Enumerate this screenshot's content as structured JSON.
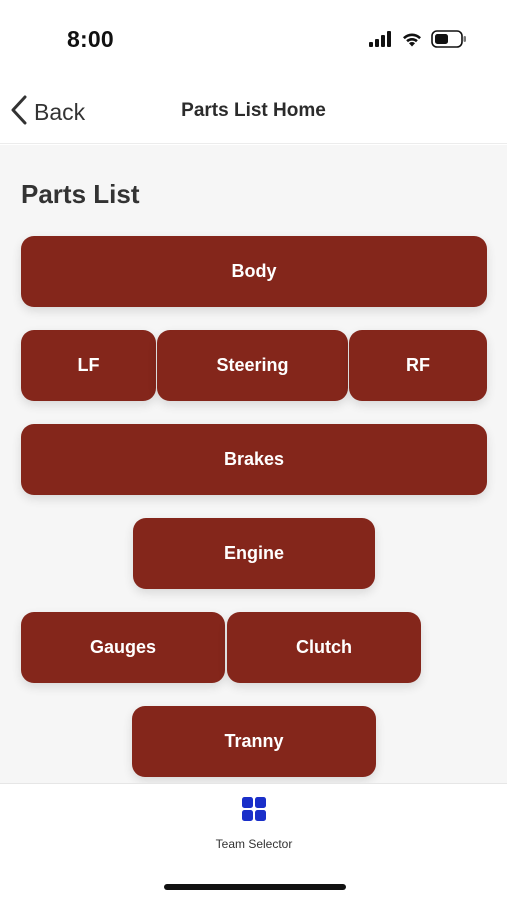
{
  "status_bar": {
    "time": "8:00",
    "icons": [
      "cellular-signal-icon",
      "wifi-icon",
      "battery-icon"
    ]
  },
  "nav": {
    "back_label": "Back",
    "title": "Parts List Home"
  },
  "main": {
    "section_title": "Parts List",
    "buttons": {
      "body": "Body",
      "lf": "LF",
      "steering": "Steering",
      "rf": "RF",
      "brakes": "Brakes",
      "engine": "Engine",
      "gauges": "Gauges",
      "clutch": "Clutch",
      "tranny": "Tranny"
    }
  },
  "tab_bar": {
    "items": [
      {
        "label": "Team Selector",
        "icon": "grid-icon",
        "active": true
      }
    ]
  },
  "colors": {
    "button_bg": "#84261b",
    "button_text": "#ffffff",
    "tab_icon": "#1a2fc9",
    "content_bg": "#f6f6f6"
  }
}
